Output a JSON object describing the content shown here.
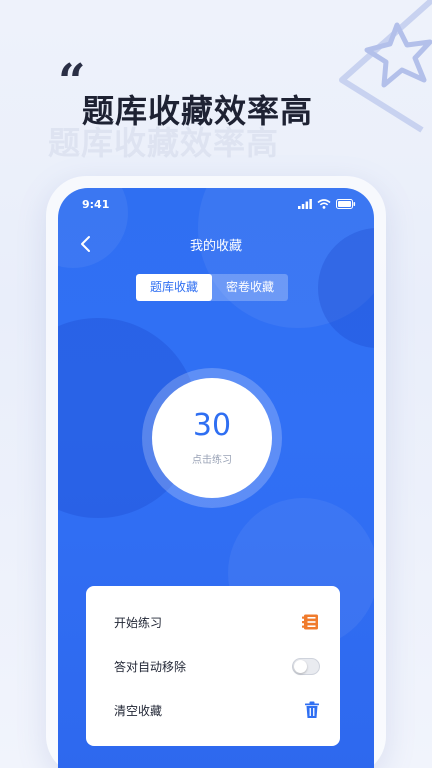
{
  "headline": {
    "quote_mark": "“",
    "title": "题库收藏效率高"
  },
  "status_bar": {
    "time": "9:41"
  },
  "nav": {
    "title": "我的收藏"
  },
  "tabs": [
    {
      "label": "题库收藏",
      "active": true
    },
    {
      "label": "密卷收藏",
      "active": false
    }
  ],
  "counter": {
    "value": "30",
    "label": "点击练习"
  },
  "menu": {
    "start_practice": "开始练习",
    "auto_remove": "答对自动移除",
    "auto_remove_enabled": false,
    "clear_favorites": "清空收藏"
  },
  "colors": {
    "primary": "#2f6ff2",
    "accent_orange": "#f07b2c",
    "headline_text": "#1e2233"
  },
  "icons": {
    "back": "chevron-left-icon",
    "start": "list-icon",
    "clear": "trash-icon"
  }
}
